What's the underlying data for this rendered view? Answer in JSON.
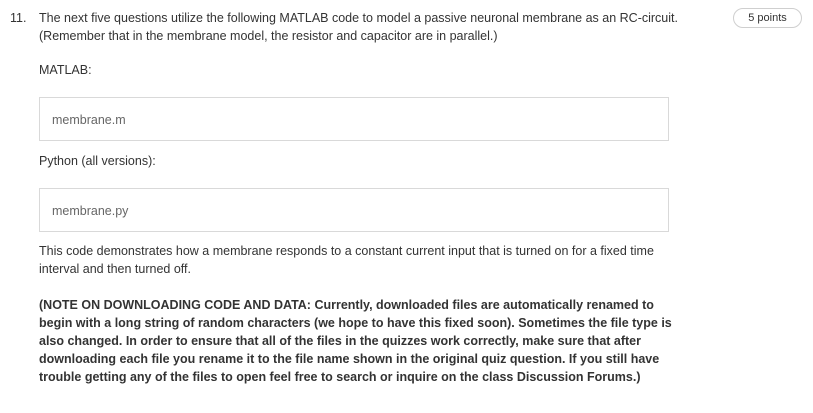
{
  "question": {
    "number": "11.",
    "points": "5 points",
    "prompt": "The next five questions utilize the following MATLAB code to model a passive neuronal membrane as an RC-circuit. (Remember that in the membrane model, the resistor and capacitor are in parallel.)",
    "matlab_label": "MATLAB:",
    "matlab_file": "membrane.m",
    "python_label": "Python (all versions):",
    "python_file": "membrane.py",
    "description": "This code demonstrates how a membrane responds to a constant current input that is turned on for a fixed time interval and then turned off.",
    "note": "(NOTE ON DOWNLOADING CODE AND DATA: Currently, downloaded files are automatically renamed to begin with a long string of random characters (we hope to have this fixed soon). Sometimes the file type is also changed. In order to ensure that all of the files in the quizzes work correctly, make sure that after downloading each file you rename it to the file name shown in the original quiz question. If you still have trouble getting any of the files to open feel free to search or inquire on the class Discussion Forums.)"
  }
}
